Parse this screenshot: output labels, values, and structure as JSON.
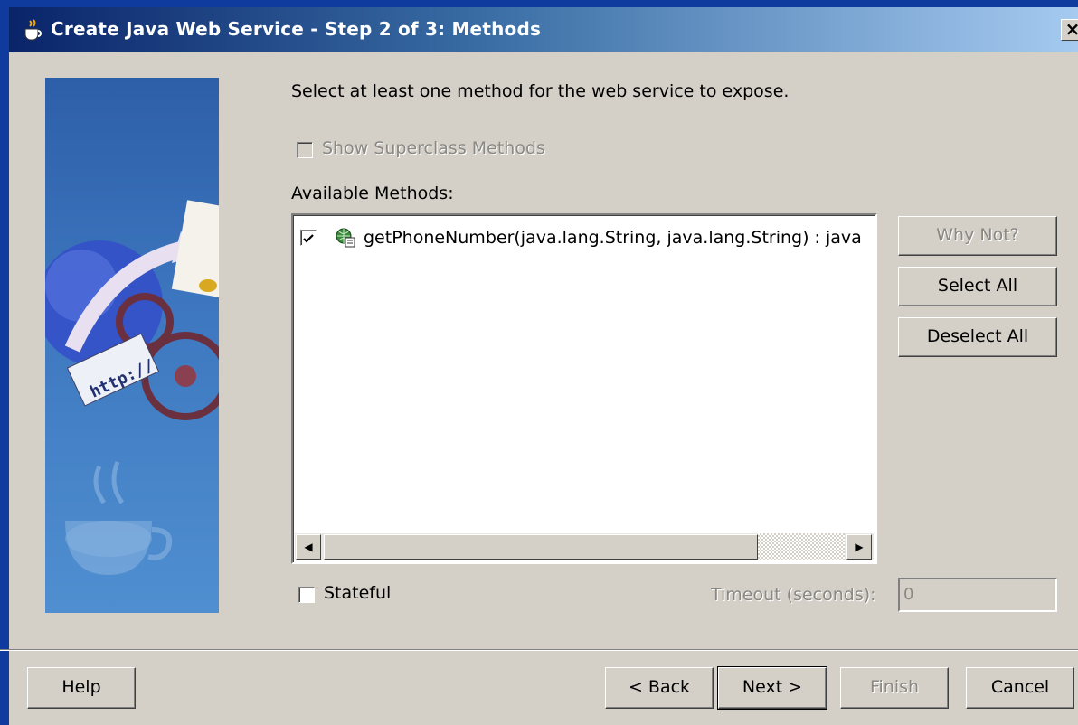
{
  "window": {
    "title": "Create Java Web Service - Step 2 of 3: Methods",
    "close_label": "×"
  },
  "instruction": "Select at least one method for the web service to expose.",
  "show_superclass": {
    "label": "Show Superclass Methods",
    "checked": false,
    "enabled": false
  },
  "available_methods": {
    "label": "Available Methods:",
    "items": [
      {
        "checked": true,
        "text": "getPhoneNumber(java.lang.String, java.lang.String) : java"
      }
    ]
  },
  "side_buttons": {
    "why_not": "Why Not?",
    "select_all": "Select All",
    "deselect_all": "Deselect All"
  },
  "stateful": {
    "label": "Stateful",
    "checked": false
  },
  "timeout": {
    "label": "Timeout (seconds):",
    "value": "0",
    "enabled": false
  },
  "footer": {
    "help": "Help",
    "back": "< Back",
    "next": "Next >",
    "finish": "Finish",
    "cancel": "Cancel"
  },
  "colors": {
    "title_gradient_start": "#0a246a",
    "title_gradient_end": "#a6caf0",
    "dialog_bg": "#d4d0c8"
  }
}
